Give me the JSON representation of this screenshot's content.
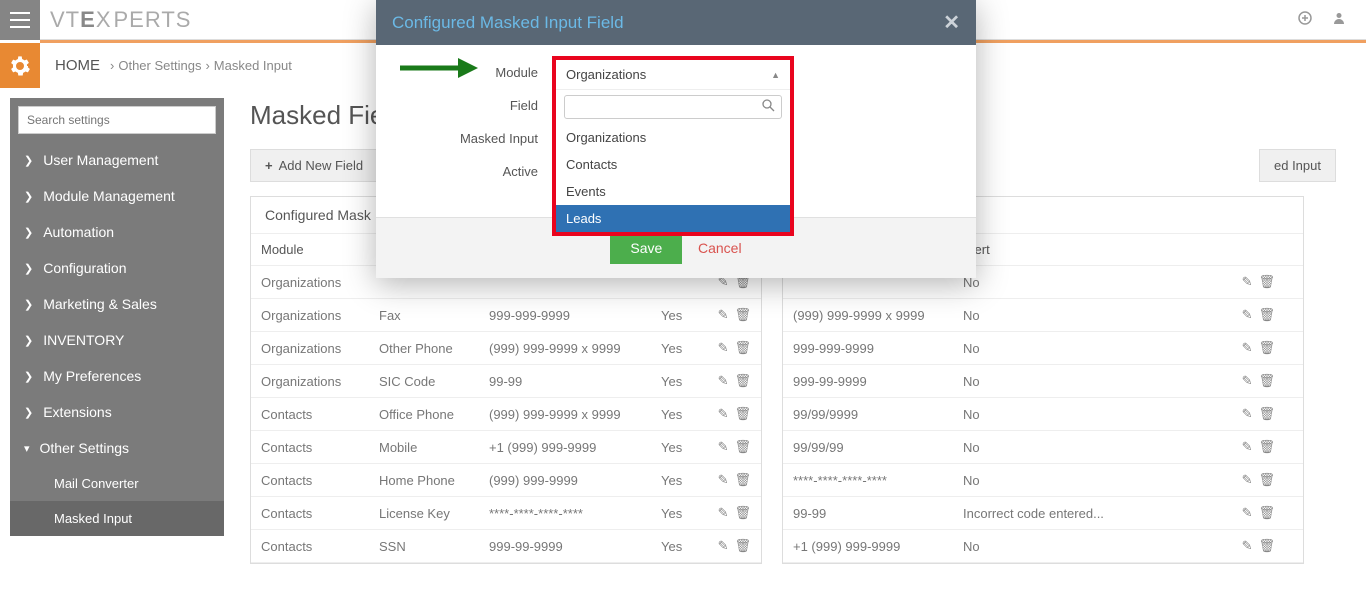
{
  "topbar": {
    "logo_prefix": "VT",
    "logo_mid": "E",
    "logo_suffix": "PERTS"
  },
  "breadcrumb": {
    "home": "HOME",
    "seg1": "Other Settings",
    "seg2": "Masked Input"
  },
  "sidebar": {
    "search_placeholder": "Search settings",
    "items": [
      {
        "label": "User Management"
      },
      {
        "label": "Module Management"
      },
      {
        "label": "Automation"
      },
      {
        "label": "Configuration"
      },
      {
        "label": "Marketing & Sales"
      },
      {
        "label": "INVENTORY"
      },
      {
        "label": "My Preferences"
      },
      {
        "label": "Extensions"
      },
      {
        "label": "Other Settings",
        "expanded": true
      }
    ],
    "subitems": [
      {
        "label": "Mail Converter"
      },
      {
        "label": "Masked Input",
        "active": true
      }
    ]
  },
  "page": {
    "title": "Masked Fields"
  },
  "toolbar": {
    "add_field": "Add New Field",
    "right_tab": "ed Input"
  },
  "left_table": {
    "title": "Configured Mask",
    "head": {
      "module": "Module",
      "field": "",
      "mask": "",
      "active": ""
    },
    "rows": [
      {
        "module": "Organizations",
        "field": "",
        "mask": "",
        "active": ""
      },
      {
        "module": "Organizations",
        "field": "Fax",
        "mask": "999-999-9999",
        "active": "Yes"
      },
      {
        "module": "Organizations",
        "field": "Other Phone",
        "mask": "(999) 999-9999 x 9999",
        "active": "Yes"
      },
      {
        "module": "Organizations",
        "field": "SIC Code",
        "mask": "99-99",
        "active": "Yes"
      },
      {
        "module": "Contacts",
        "field": "Office Phone",
        "mask": "(999) 999-9999 x 9999",
        "active": "Yes"
      },
      {
        "module": "Contacts",
        "field": "Mobile",
        "mask": "+1 (999) 999-9999",
        "active": "Yes"
      },
      {
        "module": "Contacts",
        "field": "Home Phone",
        "mask": "(999) 999-9999",
        "active": "Yes"
      },
      {
        "module": "Contacts",
        "field": "License Key",
        "mask": "****-****-****-****",
        "active": "Yes"
      },
      {
        "module": "Contacts",
        "field": "SSN",
        "mask": "999-99-9999",
        "active": "Yes"
      }
    ]
  },
  "right_table": {
    "head": {
      "mask": "",
      "alert": "Alert"
    },
    "rows": [
      {
        "mask": "",
        "alert": "No"
      },
      {
        "mask": "(999) 999-9999 x 9999",
        "alert": "No"
      },
      {
        "mask": "999-999-9999",
        "alert": "No"
      },
      {
        "mask": "999-99-9999",
        "alert": "No"
      },
      {
        "mask": "99/99/9999",
        "alert": "No"
      },
      {
        "mask": "99/99/99",
        "alert": "No"
      },
      {
        "mask": "****-****-****-****",
        "alert": "No"
      },
      {
        "mask": "99-99",
        "alert": "Incorrect code entered..."
      },
      {
        "mask": "+1 (999) 999-9999",
        "alert": "No"
      }
    ]
  },
  "modal": {
    "title": "Configured Masked Input Field",
    "labels": {
      "module": "Module",
      "field": "Field",
      "masked": "Masked Input",
      "active": "Active"
    },
    "save": "Save",
    "cancel": "Cancel"
  },
  "dropdown": {
    "selected": "Organizations",
    "options": [
      "Organizations",
      "Contacts",
      "Events",
      "Leads"
    ],
    "highlighted_index": 3
  }
}
